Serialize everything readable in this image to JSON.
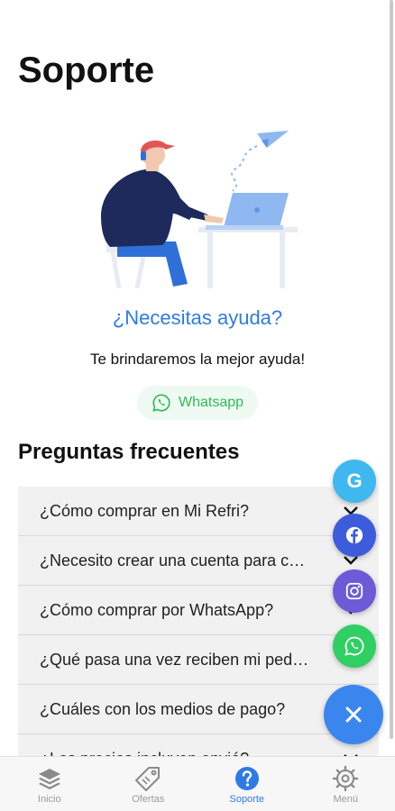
{
  "page": {
    "title": "Soporte"
  },
  "help": {
    "title": "¿Necesitas ayuda?",
    "subtitle": "Te brindaremos la mejor ayuda!",
    "whatsapp_label": "Whatsapp"
  },
  "faq": {
    "title": "Preguntas frecuentes",
    "items": [
      {
        "question": "¿Cómo comprar en Mi Refri?"
      },
      {
        "question": "¿Necesito crear una cuenta para comprar?"
      },
      {
        "question": "¿Cómo comprar por WhatsApp?"
      },
      {
        "question": "¿Qué pasa una vez reciben mi pedido?"
      },
      {
        "question": "¿Cuáles con los medios de pago?"
      },
      {
        "question": "¿Los precios incluyen envió?"
      }
    ]
  },
  "fabs": {
    "google_letter": "G",
    "colors": {
      "google": "#3fb8f0",
      "facebook": "#3d5cdc",
      "instagram": "#6b5bd6",
      "whatsapp": "#2fcf63",
      "main": "#3b86ee"
    }
  },
  "nav": {
    "items": [
      {
        "label": "Inicio",
        "icon": "layers-icon"
      },
      {
        "label": "Ofertas",
        "icon": "tag-icon"
      },
      {
        "label": "Soporte",
        "icon": "help-icon"
      },
      {
        "label": "Menú",
        "icon": "gear-icon"
      }
    ],
    "active_index": 2
  },
  "accent_color": "#2f7be5"
}
